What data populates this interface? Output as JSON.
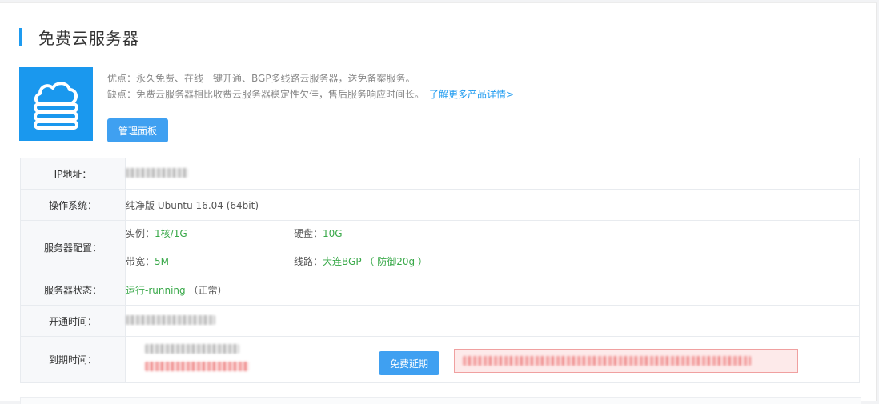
{
  "page": {
    "title": "免费云服务器"
  },
  "product": {
    "icon": "cloud-server-icon",
    "pros": "优点：永久免费、在线一键开通、BGP多线路云服务器，送免备案服务。",
    "cons": "缺点：免费云服务器相比收费云服务器稳定性欠佳，售后服务响应时间长。",
    "learn_more_link": "了解更多产品详情>",
    "manage_button": "管理面板"
  },
  "info": {
    "ip_label": "IP地址：",
    "os_label": "操作系统：",
    "os_value": "纯净版 Ubuntu 16.04 (64bit)",
    "config_label": "服务器配置：",
    "config": {
      "instance_label": "实例：",
      "instance_value": "1核/1G",
      "disk_label": "硬盘：",
      "disk_value": "10G",
      "bandwidth_label": "带宽：",
      "bandwidth_value": "5M",
      "line_label": "线路：",
      "line_value": "大连BGP （ 防御20g ）"
    },
    "status_label": "服务器状态：",
    "status_value": "运行-running",
    "status_note": "（正常）",
    "open_time_label": "开通时间：",
    "expire_label": "到期时间：",
    "renew_button": "免费延期"
  },
  "colors": {
    "accent": "#1e9bf0",
    "button": "#3fa0f1",
    "success": "#3aa94a",
    "warning_bg": "#fdeaea"
  }
}
